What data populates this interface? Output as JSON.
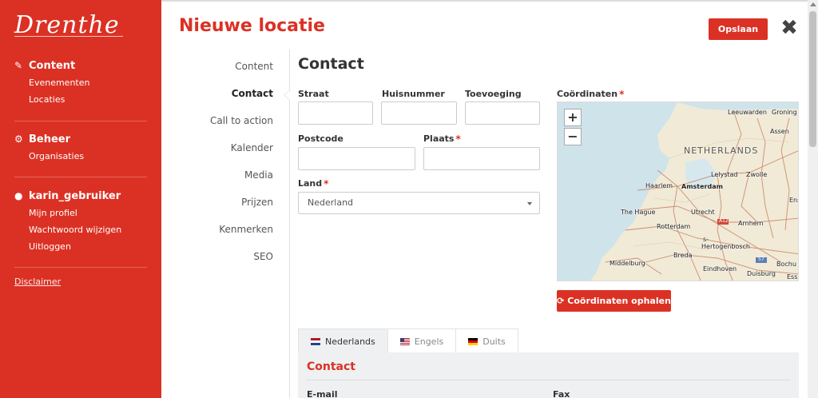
{
  "sidebar": {
    "logo": "Drenthe",
    "groups": [
      {
        "title": "Content",
        "icon": "edit-icon",
        "items": [
          "Evenementen",
          "Locaties"
        ]
      },
      {
        "title": "Beheer",
        "icon": "gears-icon",
        "items": [
          "Organisaties"
        ]
      },
      {
        "title": "karin_gebruiker",
        "icon": "user-circle-icon",
        "items": [
          "Mijn profiel",
          "Wachtwoord wijzigen",
          "Uitloggen"
        ]
      }
    ],
    "disclaimer": "Disclaimer"
  },
  "header": {
    "title": "Nieuwe locatie",
    "save_label": "Opslaan",
    "close_glyph": "✖"
  },
  "section_nav": {
    "items": [
      "Content",
      "Contact",
      "Call to action",
      "Kalender",
      "Media",
      "Prijzen",
      "Kenmerken",
      "SEO"
    ],
    "active": "Contact"
  },
  "form": {
    "title": "Contact",
    "fields": {
      "straat": {
        "label": "Straat",
        "value": ""
      },
      "huisnummer": {
        "label": "Huisnummer",
        "value": ""
      },
      "toevoeging": {
        "label": "Toevoeging",
        "value": ""
      },
      "postcode": {
        "label": "Postcode",
        "value": ""
      },
      "plaats": {
        "label": "Plaats",
        "value": "",
        "required": "*"
      },
      "land": {
        "label": "Land",
        "value": "Nederland",
        "required": "*"
      }
    },
    "coordinates": {
      "label": "Coördinaten",
      "required": "*",
      "button_label": "Coördinaten ophalen",
      "zoom_in": "+",
      "zoom_out": "−"
    }
  },
  "map": {
    "country_label": "NETHERLANDS",
    "places": [
      "Leeuwarden",
      "Groning",
      "Assen",
      "Lelystad",
      "Zwolle",
      "Haarlem",
      "Amsterdam",
      "Ens",
      "The Hague",
      "Utrecht",
      "Arnhem",
      "Rotterdam",
      "s-",
      "Hertogenbosch",
      "Breda",
      "Middelburg",
      "Eindhoven",
      "Bochu",
      "Duisburg",
      "Ess"
    ],
    "road_labels": [
      "A12",
      "57"
    ]
  },
  "lang_tabs": {
    "tabs": [
      {
        "label": "Nederlands",
        "flag": "nl-flag-icon"
      },
      {
        "label": "Engels",
        "flag": "us-flag-icon"
      },
      {
        "label": "Duits",
        "flag": "de-flag-icon"
      }
    ],
    "active": "Nederlands",
    "panel": {
      "title": "Contact",
      "email_label": "E-mail",
      "fax_label": "Fax"
    }
  },
  "colors": {
    "brand": "#db3124",
    "panel_bg": "#eef0f1",
    "map_land": "#f1ead6",
    "map_water": "#cfe3ea"
  }
}
